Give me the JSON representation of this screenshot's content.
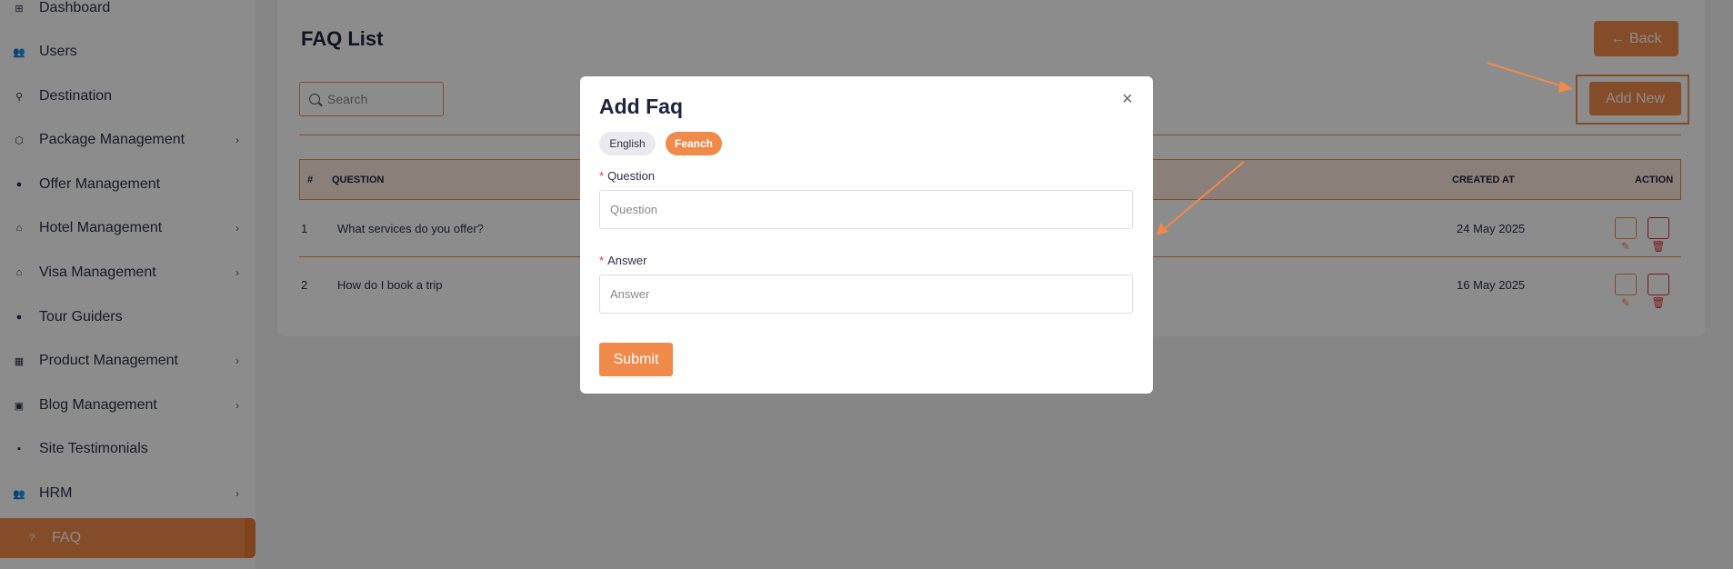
{
  "sidebar": {
    "items": [
      {
        "label": "Dashboard",
        "icon": "dashboard-icon",
        "glyph": "⊞",
        "chevron": false
      },
      {
        "label": "Users",
        "icon": "users-icon",
        "glyph": "👥",
        "chevron": false
      },
      {
        "label": "Destination",
        "icon": "destination-icon",
        "glyph": "⚲",
        "chevron": false
      },
      {
        "label": "Package Management",
        "icon": "package-icon",
        "glyph": "⬡",
        "chevron": true
      },
      {
        "label": "Offer Management",
        "icon": "offer-icon",
        "glyph": "●",
        "chevron": false
      },
      {
        "label": "Hotel Management",
        "icon": "hotel-icon",
        "glyph": "⌂",
        "chevron": true
      },
      {
        "label": "Visa Management",
        "icon": "visa-icon",
        "glyph": "⌂",
        "chevron": true
      },
      {
        "label": "Tour Guiders",
        "icon": "tour-guider-icon",
        "glyph": "●",
        "chevron": false
      },
      {
        "label": "Product Management",
        "icon": "product-icon",
        "glyph": "▦",
        "chevron": true
      },
      {
        "label": "Blog Management",
        "icon": "blog-icon",
        "glyph": "▣",
        "chevron": true
      },
      {
        "label": "Site Testimonials",
        "icon": "testimonials-icon",
        "glyph": "▪",
        "chevron": false
      },
      {
        "label": "HRM",
        "icon": "hrm-icon",
        "glyph": "👥",
        "chevron": true
      },
      {
        "label": "FAQ",
        "icon": "faq-icon",
        "glyph": "?",
        "chevron": false,
        "active": true
      }
    ],
    "chevron_glyph": "›"
  },
  "page": {
    "title": "FAQ List",
    "back_label": "← Back",
    "add_new_label": "Add New",
    "search_placeholder": "Search"
  },
  "table": {
    "columns": [
      "#",
      "QUESTION",
      "CREATED AT",
      "ACTION"
    ],
    "rows": [
      {
        "index": "1",
        "question": "What services do you offer?",
        "created_at": "24 May 2025"
      },
      {
        "index": "2",
        "question": "How do I book a trip",
        "created_at": "16 May 2025"
      }
    ]
  },
  "modal": {
    "title": "Add Faq",
    "close_glyph": "×",
    "languages": [
      "English",
      "Feanch"
    ],
    "active_language": "Feanch",
    "question_label": "Question",
    "question_placeholder": "Question",
    "answer_label": "Answer",
    "answer_placeholder": "Answer",
    "required_mark": "*",
    "submit_label": "Submit"
  },
  "colors": {
    "accent": "#f08a4b",
    "danger": "#d9303a"
  }
}
